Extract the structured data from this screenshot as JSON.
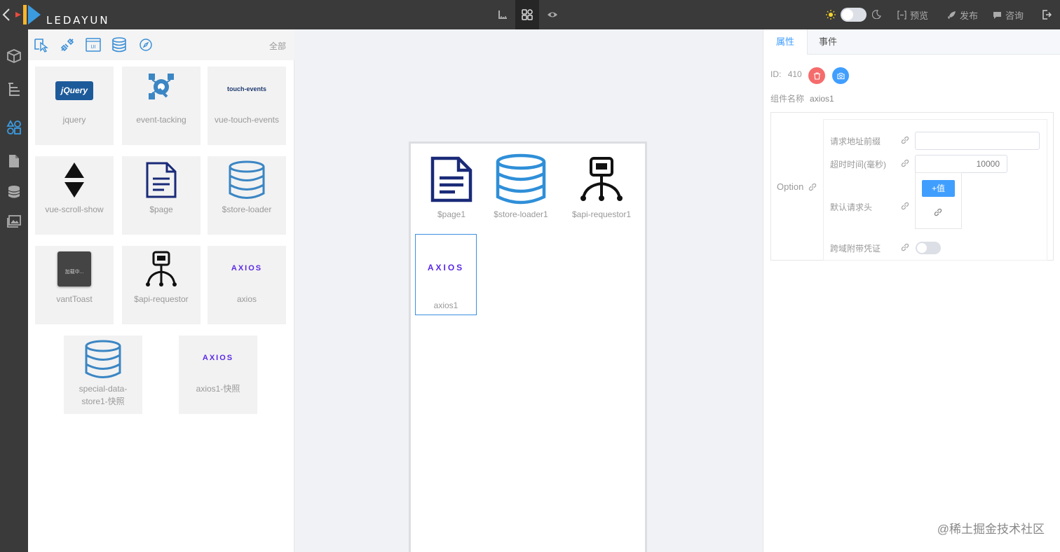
{
  "topbar": {
    "logo_text": "LEDAYUN",
    "preview_label": "预览",
    "publish_label": "发布",
    "consult_label": "咨询"
  },
  "panel": {
    "all_label": "全部",
    "cards": [
      {
        "label": "jquery",
        "icon": "jquery-logo"
      },
      {
        "label": "event-tacking",
        "icon": "event-tracking-icon"
      },
      {
        "label": "vue-touch-events",
        "icon": "touch-events-logo",
        "text": "touch-events"
      },
      {
        "label": "vue-scroll-show",
        "icon": "scroll-arrows-icon"
      },
      {
        "label": "$page",
        "icon": "page-icon"
      },
      {
        "label": "$store-loader",
        "icon": "database-icon"
      },
      {
        "label": "vantToast",
        "icon": "vant-toast-icon",
        "text": "加载中..."
      },
      {
        "label": "$api-requestor",
        "icon": "api-requestor-icon"
      },
      {
        "label": "axios",
        "icon": "axios-logo"
      },
      {
        "label": "special-data-store1-快照",
        "icon": "database-icon"
      },
      {
        "label": "axios1-快照",
        "icon": "axios-logo"
      }
    ]
  },
  "canvas": {
    "instances": [
      {
        "label": "$page1"
      },
      {
        "label": "$store-loader1"
      },
      {
        "label": "$api-requestor1"
      },
      {
        "label": "axios1"
      }
    ]
  },
  "props": {
    "tabs": [
      "属性",
      "事件"
    ],
    "id_label": "ID:",
    "id_value": "410",
    "name_label": "组件名称",
    "name_value": "axios1",
    "option_label": "Option",
    "rows": {
      "base_url_label": "请求地址前缀",
      "base_url_value": "",
      "timeout_label": "超时时间(毫秒)",
      "timeout_value": "10000",
      "headers_label": "默认请求头",
      "add_value_label": "+值",
      "credentials_label": "跨域附带凭证"
    }
  },
  "logos": {
    "jquery": "jQuery",
    "axios": "AXIOS"
  },
  "watermark": "@稀土掘金技术社区",
  "colors": {
    "accent": "#409eff",
    "delete_btn": "#f56c6c",
    "snapshot_btn": "#409eff",
    "topbar_bg": "#3a3a3a"
  }
}
